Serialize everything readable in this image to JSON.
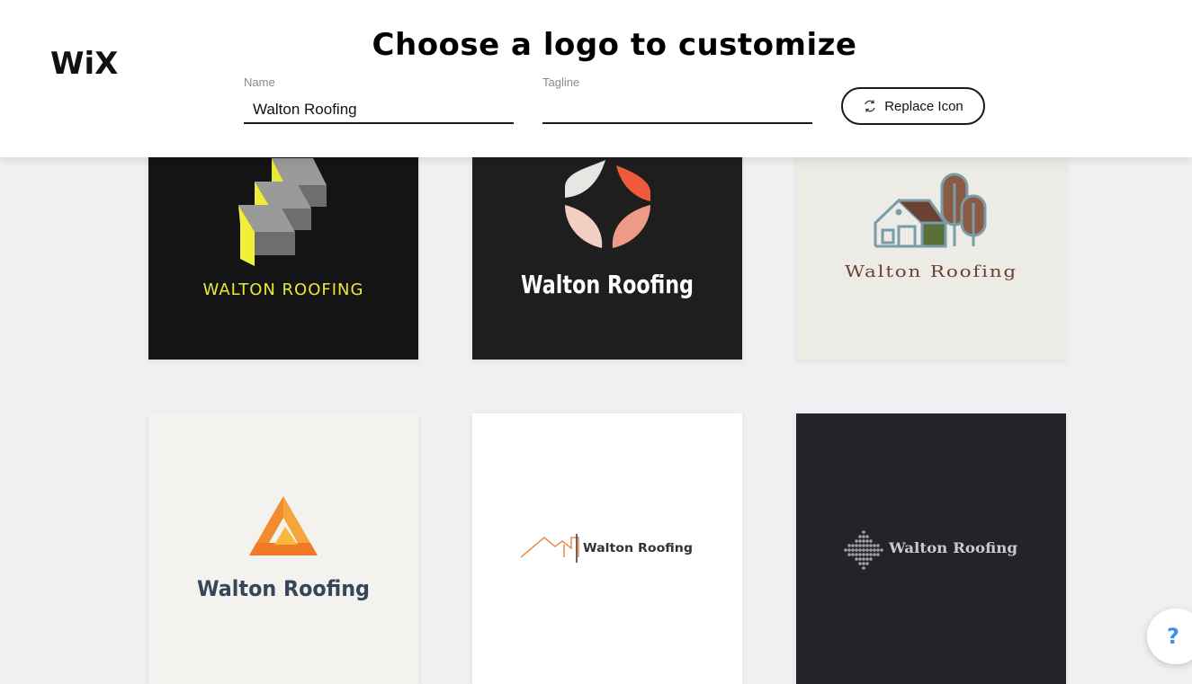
{
  "header": {
    "brand_logo": "WiX",
    "title": "Choose a logo to customize",
    "name_label": "Name",
    "name_value": "Walton Roofing",
    "tagline_label": "Tagline",
    "tagline_value": "",
    "replace_button_label": "Replace Icon",
    "replace_icon": "refresh-icon"
  },
  "logos": [
    {
      "text": "WALTON ROOFING",
      "icon": "stacked-shingles-icon",
      "background": "#141414",
      "text_color": "#e6ea34"
    },
    {
      "text": "Walton Roofing",
      "icon": "leaf-petals-icon",
      "background": "#1e1e1e",
      "text_color": "#ffffff"
    },
    {
      "text": "Walton Roofing",
      "icon": "barn-trees-icon",
      "background": "#ecebe6",
      "text_color": "#6b4232"
    },
    {
      "text": "Walton Roofing",
      "icon": "penrose-triangle-icon",
      "background": "#f3f2ef",
      "text_color": "#36455a"
    },
    {
      "text": "Walton Roofing",
      "icon": "roofline-icon",
      "background": "#ffffff",
      "text_color": "#333333"
    },
    {
      "text": "Walton Roofing",
      "icon": "dotted-diamond-icon",
      "background": "#23232a",
      "text_color": "#c9c9cf"
    }
  ],
  "help_button": {
    "label": "?",
    "icon": "help-icon"
  }
}
